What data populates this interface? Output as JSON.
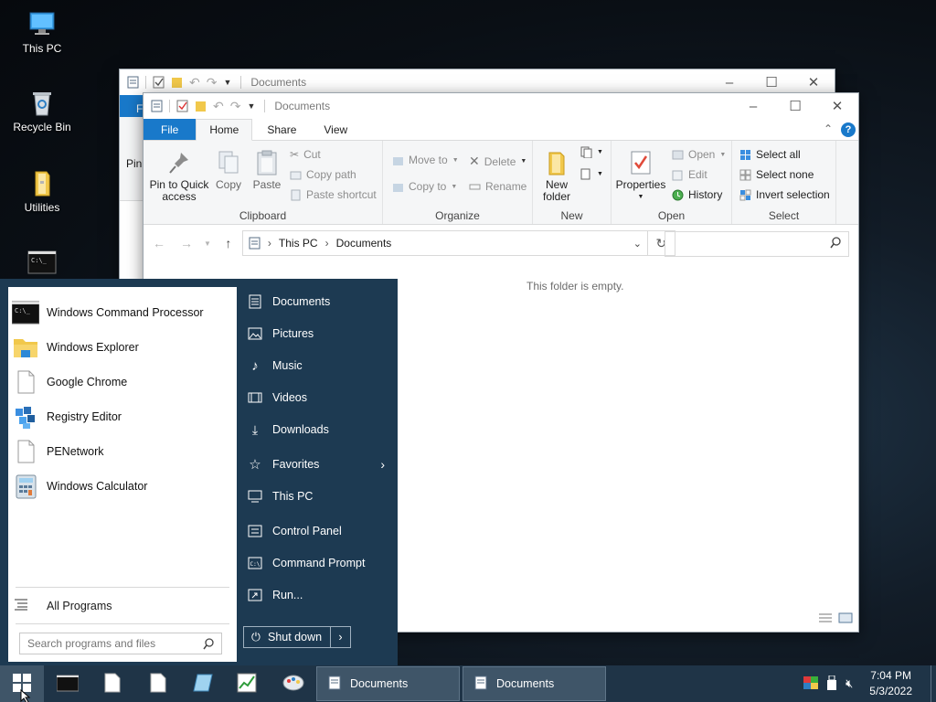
{
  "desktop": {
    "icons": [
      {
        "label": "This PC"
      },
      {
        "label": "Recycle Bin"
      },
      {
        "label": "Utilities"
      },
      {
        "label": ""
      }
    ]
  },
  "back_window": {
    "title": "Documents",
    "file_tab": "F",
    "partial_label": "Pin"
  },
  "explorer": {
    "title": "Documents",
    "tabs": {
      "file": "File",
      "home": "Home",
      "share": "Share",
      "view": "View"
    },
    "ribbon": {
      "clipboard": {
        "label": "Clipboard",
        "pin": "Pin to Quick access",
        "copy": "Copy",
        "paste": "Paste",
        "cut": "Cut",
        "copy_path": "Copy path",
        "paste_shortcut": "Paste shortcut"
      },
      "organize": {
        "label": "Organize",
        "move_to": "Move to",
        "copy_to": "Copy to",
        "delete": "Delete",
        "rename": "Rename"
      },
      "new": {
        "label": "New",
        "new_folder": "New folder"
      },
      "open": {
        "label": "Open",
        "properties": "Properties",
        "open": "Open",
        "edit": "Edit",
        "history": "History"
      },
      "select": {
        "label": "Select",
        "select_all": "Select all",
        "select_none": "Select none",
        "invert": "Invert selection"
      }
    },
    "address": {
      "root": "This PC",
      "current": "Documents"
    },
    "search_placeholder": "",
    "empty_message": "This folder is empty."
  },
  "start_menu": {
    "programs": [
      {
        "label": "Windows Command Processor",
        "icon": "cmd-icon"
      },
      {
        "label": "Windows Explorer",
        "icon": "folder-icon"
      },
      {
        "label": "Google Chrome",
        "icon": "file-icon"
      },
      {
        "label": "Registry Editor",
        "icon": "registry-icon"
      },
      {
        "label": "PENetwork",
        "icon": "file-icon"
      },
      {
        "label": "Windows Calculator",
        "icon": "calculator-icon"
      }
    ],
    "all_programs": "All Programs",
    "search_placeholder": "Search programs and files",
    "right_items": [
      {
        "label": "Documents",
        "icon": "document-icon"
      },
      {
        "label": "Pictures",
        "icon": "pictures-icon"
      },
      {
        "label": "Music",
        "icon": "music-icon"
      },
      {
        "label": "Videos",
        "icon": "videos-icon"
      },
      {
        "label": "Downloads",
        "icon": "download-icon"
      },
      {
        "label": "Favorites",
        "icon": "star-icon"
      },
      {
        "label": "This PC",
        "icon": "computer-icon"
      },
      {
        "label": "Control Panel",
        "icon": "control-panel-icon"
      },
      {
        "label": "Command Prompt",
        "icon": "cmd-icon"
      },
      {
        "label": "Run...",
        "icon": "run-icon"
      }
    ],
    "shutdown": "Shut down"
  },
  "taskbar": {
    "tasks": [
      {
        "label": "Documents"
      },
      {
        "label": "Documents"
      }
    ],
    "clock": {
      "time": "7:04 PM",
      "date": "5/3/2022"
    }
  },
  "colors": {
    "accent": "#1979ca",
    "start_menu_bg": "#1d3a52",
    "taskbar_bg": "#1f3447"
  }
}
